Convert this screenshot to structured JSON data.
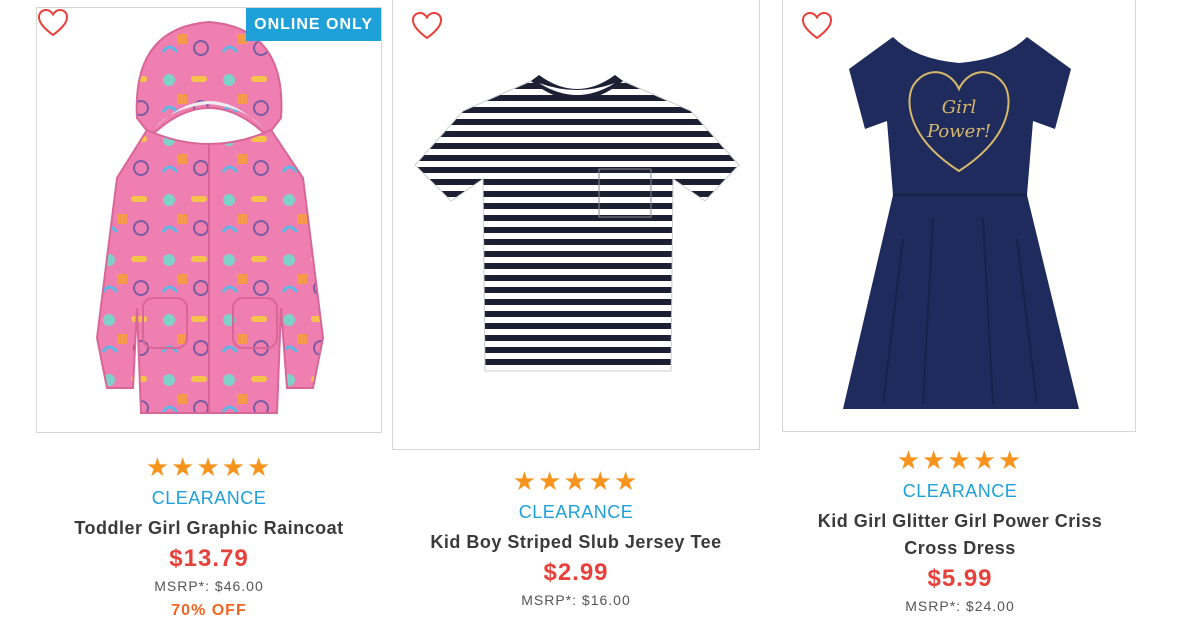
{
  "colors": {
    "accent_blue": "#1ea0d8",
    "price_red": "#e8413b",
    "star_orange": "#f7941d",
    "discount_orange": "#f26522"
  },
  "products": [
    {
      "badge": "ONLINE ONLY",
      "rating": 5,
      "stars": "★★★★★",
      "tag": "CLEARANCE",
      "title": "Toddler Girl Graphic Raincoat",
      "price": "$13.79",
      "msrp": "MSRP*: $46.00",
      "discount": "70% OFF",
      "favorite_icon": "heart-outline-icon"
    },
    {
      "rating": 5,
      "stars": "★★★★★",
      "tag": "CLEARANCE",
      "title": "Kid Boy Striped Slub Jersey Tee",
      "price": "$2.99",
      "msrp": "MSRP*: $16.00",
      "favorite_icon": "heart-outline-icon"
    },
    {
      "rating": 5,
      "stars": "★★★★★",
      "tag": "CLEARANCE",
      "title_line1": "Kid Girl Glitter Girl Power Criss",
      "title_line2": "Cross Dress",
      "price": "$5.99",
      "msrp": "MSRP*: $24.00",
      "print_text_1": "Girl",
      "print_text_2": "Power!",
      "favorite_icon": "heart-outline-icon"
    }
  ]
}
